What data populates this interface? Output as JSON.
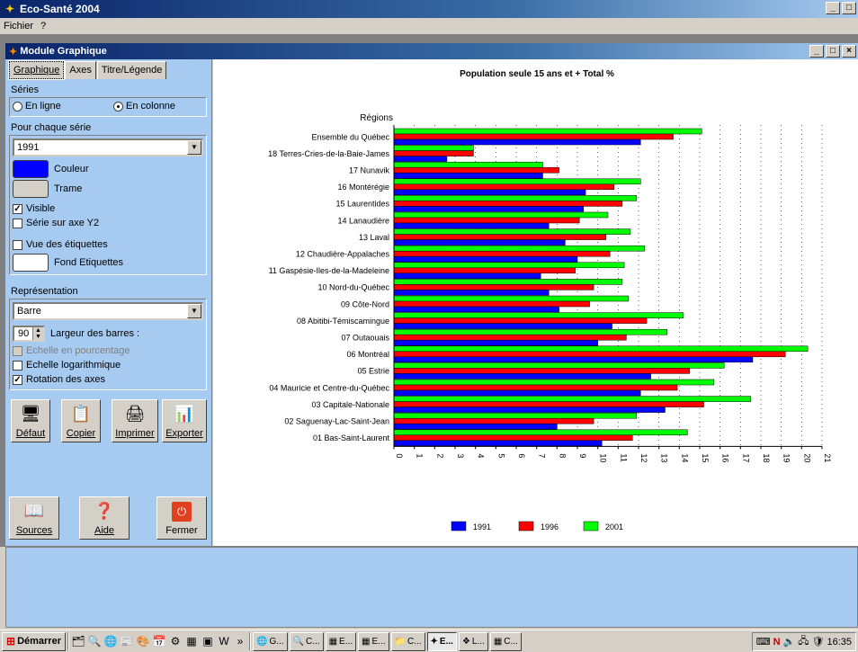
{
  "app": {
    "title": "Eco-Santé 2004",
    "menu": [
      "Fichier",
      "?"
    ]
  },
  "child": {
    "title": "Module Graphique"
  },
  "tabs": [
    "Graphique",
    "Axes",
    "Titre/Légende"
  ],
  "series_group": {
    "label": "Séries",
    "option_row": "En ligne",
    "option_col": "En colonne",
    "selected": "En colonne"
  },
  "per_series": {
    "label": "Pour chaque série",
    "selected_series": "1991",
    "color_label": "Couleur",
    "color": "#0000ff",
    "frame_label": "Trame",
    "visible_label": "Visible",
    "visible": true,
    "y2_label": "Série sur axe Y2",
    "y2": false,
    "show_labels_label": "Vue des étiquettes",
    "show_labels": false,
    "label_bg_label": "Fond Etiquettes"
  },
  "representation": {
    "label": "Représentation",
    "type": "Barre",
    "bar_width_value": "90",
    "bar_width_label": "Largeur des barres :",
    "pct_scale_label": "Echelle en pourcentage",
    "log_scale_label": "Echelle logarithmique",
    "rotation_label": "Rotation des axes",
    "pct_scale": false,
    "log_scale": false,
    "rotation": true
  },
  "toolbar": {
    "default_label": "Défaut",
    "copy_label": "Copier",
    "print_label": "Imprimer",
    "export_label": "Exporter",
    "sources_label": "Sources",
    "help_label": "Aide",
    "close_label": "Fermer"
  },
  "chart_data": {
    "type": "bar",
    "orientation": "horizontal",
    "title": "Population seule 15 ans et + Total %",
    "ylabel": "Régions",
    "xlim": [
      0,
      21
    ],
    "xticks": [
      "0",
      "1",
      "2",
      "3",
      "4",
      "5",
      "6",
      "7",
      "8",
      "9",
      "10",
      "11",
      "12",
      "13",
      "14",
      "15",
      "16",
      "17",
      "18",
      "19",
      "20",
      "21"
    ],
    "grid": true,
    "legend_position": "bottom",
    "categories": [
      "Ensemble du Québec",
      "18 Terres-Cries-de-la-Baie-James",
      "17 Nunavik",
      "16 Montérégie",
      "15 Laurentides",
      "14 Lanaudière",
      "13 Laval",
      "12 Chaudière-Appalaches",
      "11 Gaspésie-Iles-de-la-Madeleine",
      "10 Nord-du-Québec",
      "09 Côte-Nord",
      "08 Abitibi-Témiscamingue",
      "07 Outaouais",
      "06 Montréal",
      "05 Estrie",
      "04 Mauricie et Centre-du-Québec",
      "03 Capitale-Nationale",
      "02 Saguenay-Lac-Saint-Jean",
      "01 Bas-Saint-Laurent"
    ],
    "series": [
      {
        "name": "2001",
        "color": "#00ff00",
        "values": [
          15.1,
          3.9,
          7.3,
          12.1,
          11.9,
          10.5,
          11.6,
          12.3,
          11.3,
          11.2,
          11.5,
          14.2,
          13.4,
          20.3,
          16.2,
          15.7,
          17.5,
          11.9,
          14.4
        ]
      },
      {
        "name": "1996",
        "color": "#ff0000",
        "values": [
          13.7,
          3.9,
          8.1,
          10.8,
          11.2,
          9.1,
          10.4,
          10.6,
          8.9,
          9.8,
          9.6,
          12.4,
          11.4,
          19.2,
          14.5,
          13.9,
          15.2,
          9.8,
          11.7
        ]
      },
      {
        "name": "1991",
        "color": "#0000ff",
        "values": [
          12.1,
          2.6,
          7.3,
          9.4,
          9.3,
          7.6,
          8.4,
          9.0,
          7.2,
          7.6,
          8.1,
          10.7,
          10.0,
          17.6,
          12.6,
          12.1,
          13.3,
          8.0,
          10.2
        ]
      }
    ],
    "legend": [
      {
        "name": "1991",
        "color": "#0000ff"
      },
      {
        "name": "1996",
        "color": "#ff0000"
      },
      {
        "name": "2001",
        "color": "#00ff00"
      }
    ]
  },
  "taskbar": {
    "start_label": "Démarrer",
    "buttons": [
      "G...",
      "C...",
      "E...",
      "E...",
      "C...",
      "E...",
      "L...",
      "C..."
    ],
    "active_index": 5,
    "clock": "16:35"
  }
}
